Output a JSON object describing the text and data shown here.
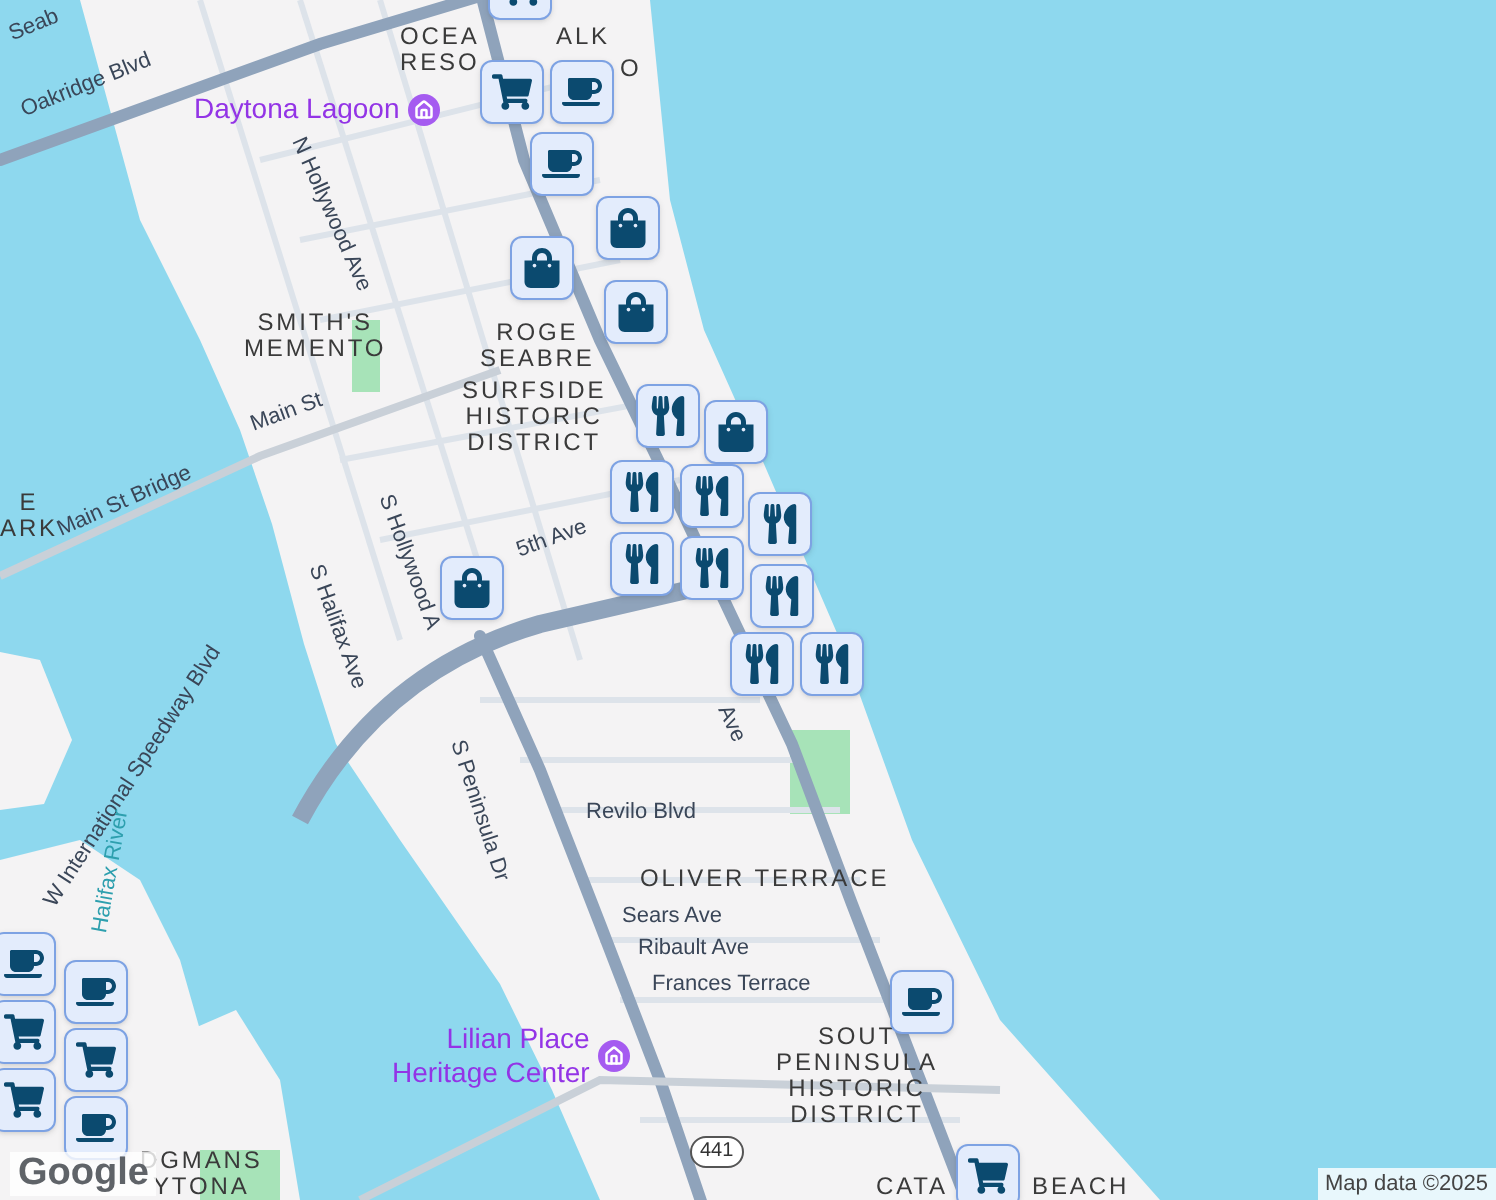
{
  "map": {
    "labels": [
      {
        "kind": "road",
        "lines": [
          "Seab"
        ]
      },
      {
        "kind": "road",
        "lines": [
          "Oakridge Blvd"
        ]
      },
      {
        "kind": "district",
        "lines": [
          "OCEA",
          "RESO"
        ]
      },
      {
        "kind": "district",
        "lines": [
          "ALK"
        ]
      },
      {
        "kind": "district",
        "lines": [
          "O"
        ]
      },
      {
        "kind": "poi",
        "lines": [
          "Daytona Lagoon"
        ]
      },
      {
        "kind": "road",
        "lines": [
          "N Hollywood Ave"
        ]
      },
      {
        "kind": "district",
        "lines": [
          "SMITH'S",
          "MEMENTO"
        ]
      },
      {
        "kind": "district",
        "lines": [
          "ROGE",
          "SEABRE"
        ]
      },
      {
        "kind": "district",
        "lines": [
          "SURFSIDE",
          "HISTORIC",
          "DISTRICT"
        ]
      },
      {
        "kind": "road",
        "lines": [
          "Main St"
        ]
      },
      {
        "kind": "road",
        "lines": [
          "Main St Bridge"
        ]
      },
      {
        "kind": "district",
        "lines": [
          "E",
          "ARK"
        ]
      },
      {
        "kind": "road",
        "lines": [
          "S Halifax Ave"
        ]
      },
      {
        "kind": "road",
        "lines": [
          "S Hollywood A"
        ]
      },
      {
        "kind": "road",
        "lines": [
          "5th Ave"
        ]
      },
      {
        "kind": "road",
        "lines": [
          "S Peninsula Dr"
        ]
      },
      {
        "kind": "road",
        "lines": [
          "Ave"
        ]
      },
      {
        "kind": "road",
        "lines": [
          "W International Speedway Blvd"
        ]
      },
      {
        "kind": "water",
        "lines": [
          "Halifax River"
        ]
      },
      {
        "kind": "road",
        "lines": [
          "Revilo Blvd"
        ]
      },
      {
        "kind": "district",
        "lines": [
          "OLIVER TERRACE"
        ]
      },
      {
        "kind": "road",
        "lines": [
          "Sears Ave"
        ]
      },
      {
        "kind": "road",
        "lines": [
          "Ribault Ave"
        ]
      },
      {
        "kind": "road",
        "lines": [
          "Frances Terrace"
        ]
      },
      {
        "kind": "poi",
        "lines": [
          "Lilian Place",
          "Heritage Center"
        ]
      },
      {
        "kind": "shield",
        "lines": [
          "441"
        ]
      },
      {
        "kind": "district",
        "lines": [
          "SOUT",
          "PENINSULA",
          "HISTORIC",
          "DISTRICT"
        ]
      },
      {
        "kind": "district",
        "lines": [
          "DGMANS",
          "YTONA"
        ]
      },
      {
        "kind": "district",
        "lines": [
          "CATA"
        ]
      },
      {
        "kind": "district",
        "lines": [
          "BEACH"
        ]
      }
    ],
    "logo": "Google",
    "attribution": "Map data ©2025"
  }
}
